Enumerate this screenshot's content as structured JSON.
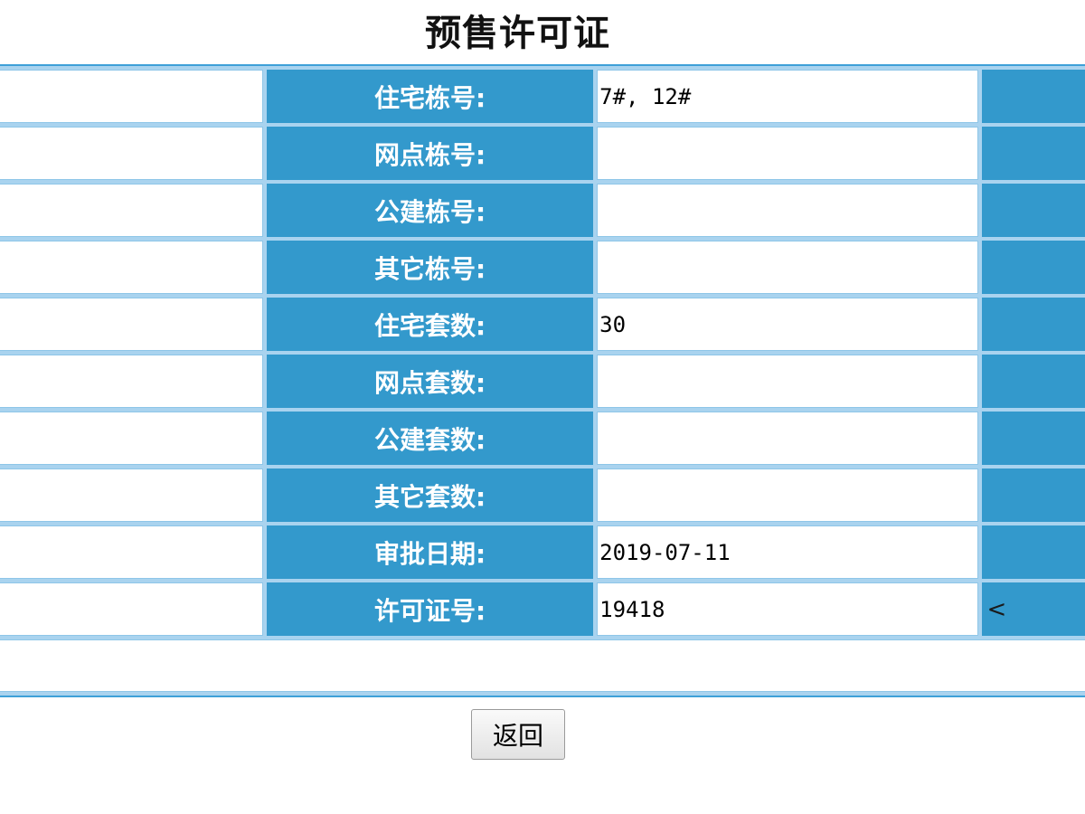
{
  "page": {
    "title": "预售许可证"
  },
  "permit_rows": [
    {
      "label": "住宅栋号:",
      "value": "7#, 12#",
      "side": ""
    },
    {
      "label": "网点栋号:",
      "value": "",
      "side": ""
    },
    {
      "label": "公建栋号:",
      "value": "",
      "side": ""
    },
    {
      "label": "其它栋号:",
      "value": "",
      "side": ""
    },
    {
      "label": "住宅套数:",
      "value": "30",
      "side": ""
    },
    {
      "label": "网点套数:",
      "value": "",
      "side": ""
    },
    {
      "label": "公建套数:",
      "value": "",
      "side": ""
    },
    {
      "label": "其它套数:",
      "value": "",
      "side": ""
    },
    {
      "label": "审批日期:",
      "value": "2019-07-11",
      "side": ""
    },
    {
      "label": "许可证号:",
      "value": "19418",
      "side": "<"
    }
  ],
  "footer": {
    "back_label": "返回"
  }
}
